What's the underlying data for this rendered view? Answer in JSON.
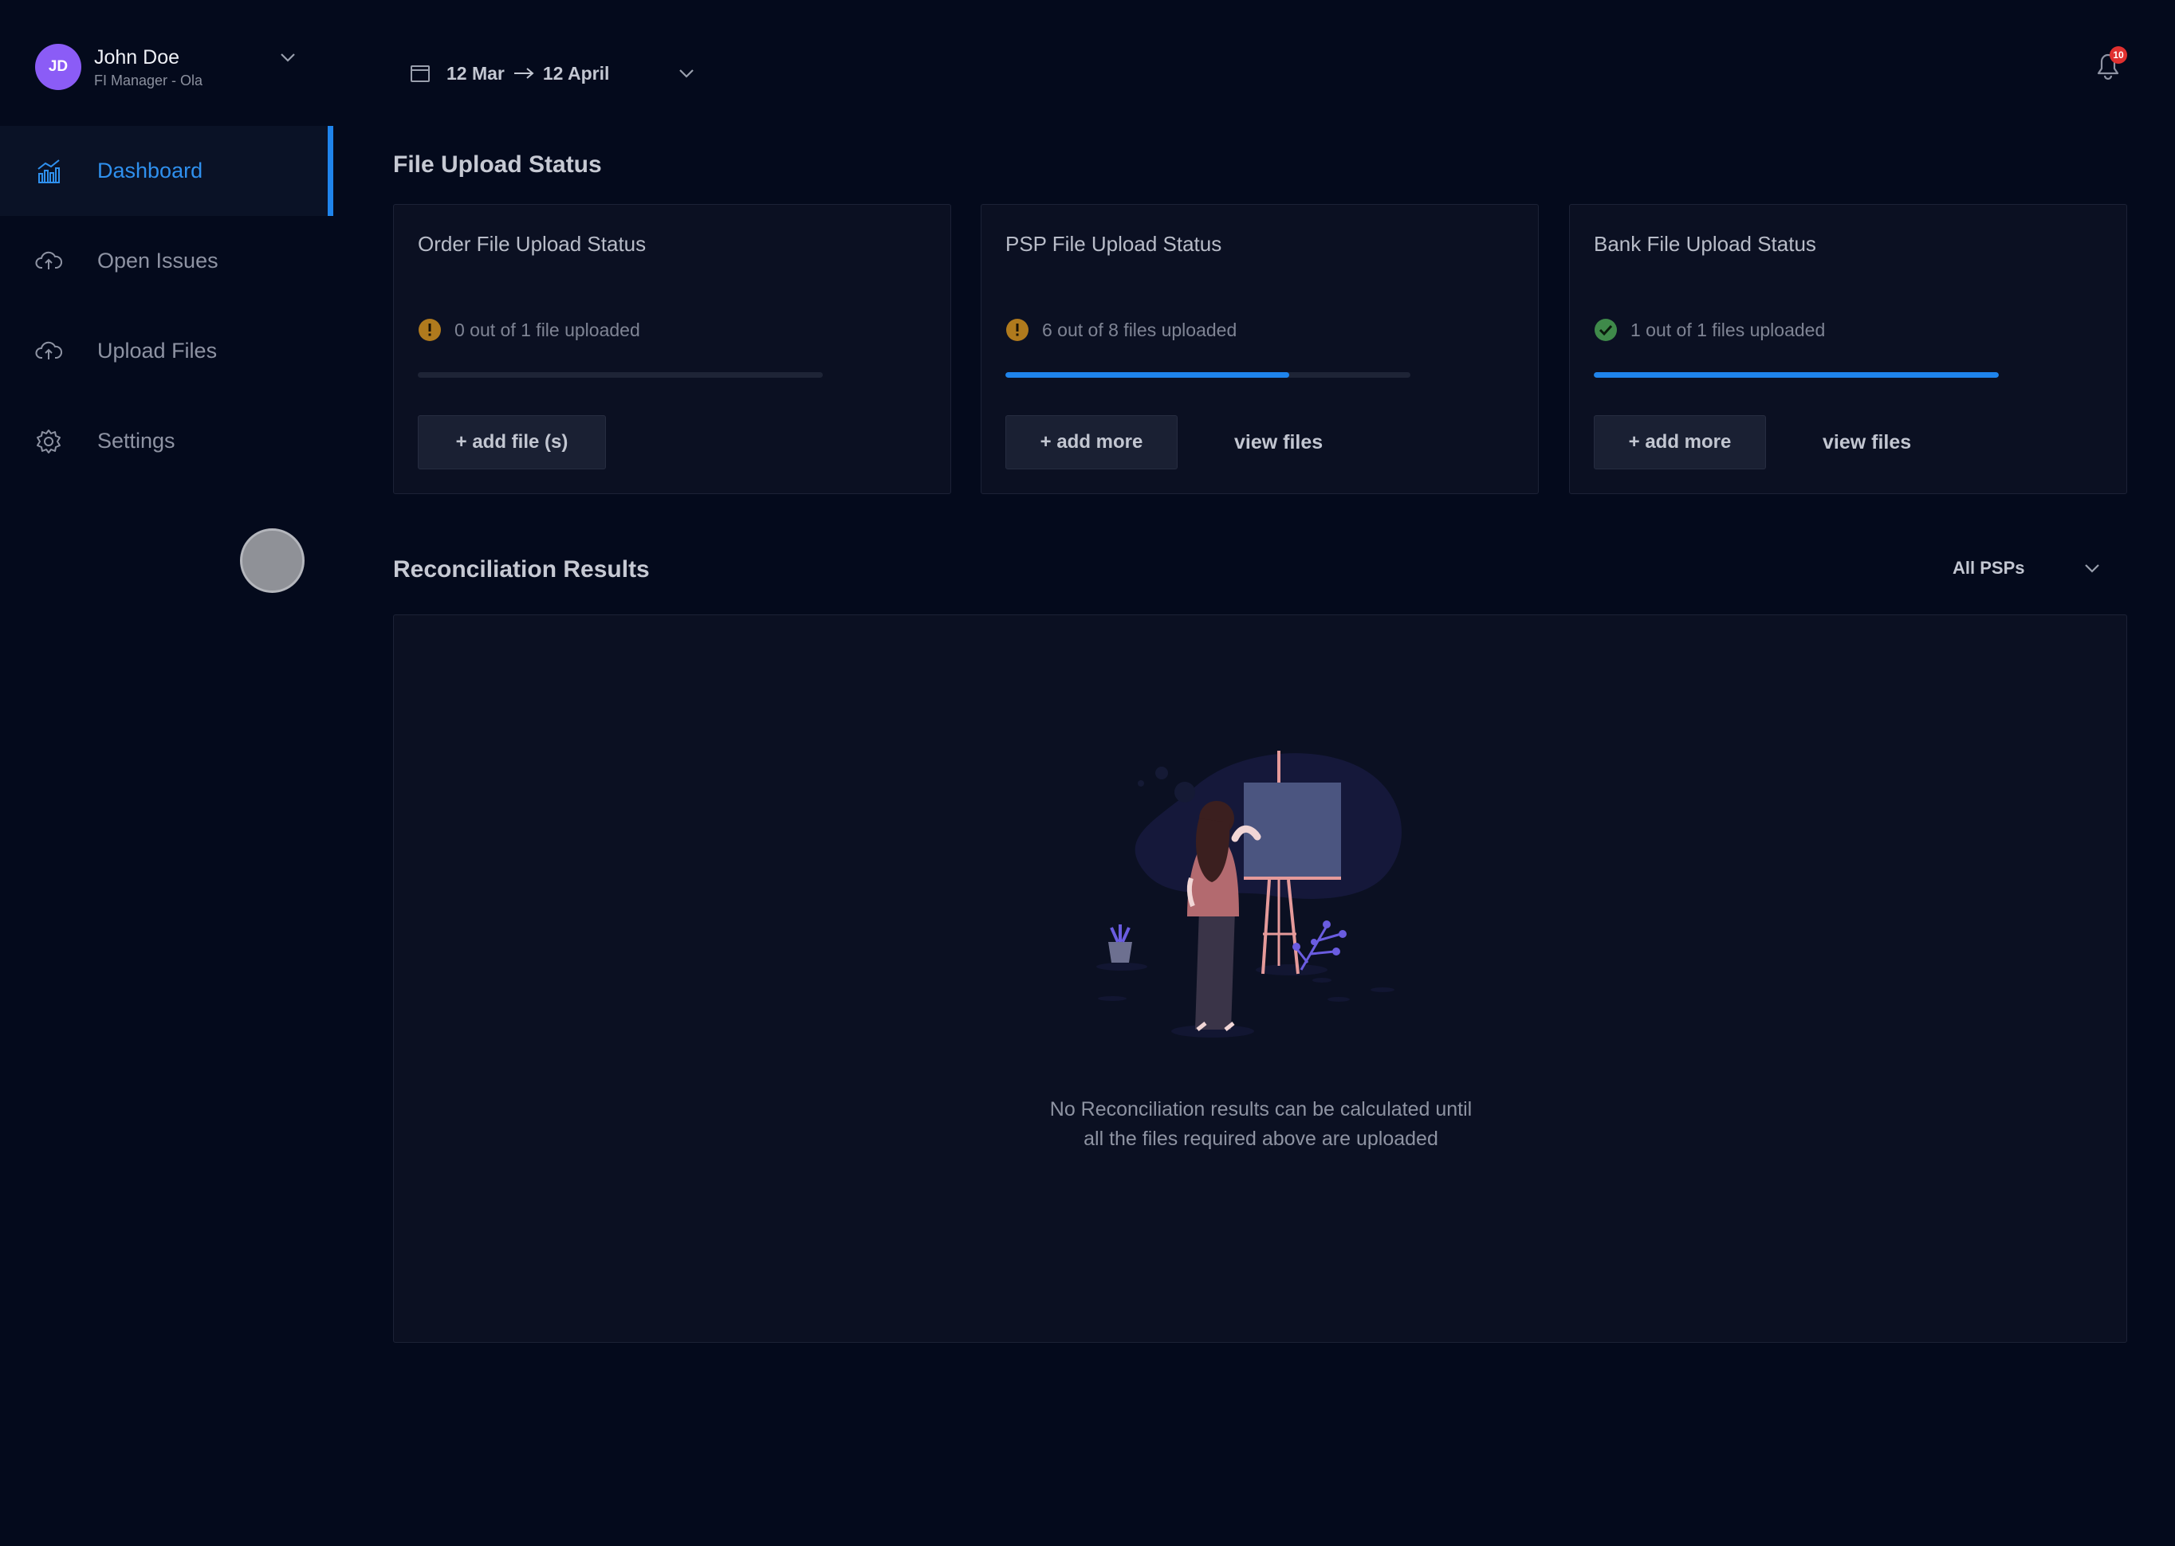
{
  "user": {
    "initials": "JD",
    "name": "John Doe",
    "role": "FI Manager - Ola"
  },
  "sidebar": {
    "items": [
      {
        "label": "Dashboard",
        "icon": "chart-icon",
        "active": true
      },
      {
        "label": "Open Issues",
        "icon": "cloud-upload-icon",
        "active": false
      },
      {
        "label": "Upload Files",
        "icon": "cloud-upload-icon",
        "active": false
      },
      {
        "label": "Settings",
        "icon": "gear-icon",
        "active": false
      }
    ]
  },
  "header": {
    "date_from": "12 Mar",
    "date_to": "12 April",
    "notification_count": "10"
  },
  "upload_status": {
    "title": "File Upload Status",
    "cards": [
      {
        "title": "Order File Upload Status",
        "status_text": "0 out of 1 file uploaded",
        "status": "warning",
        "progress": 0,
        "primary_label": "+ add file (s)",
        "secondary_label": ""
      },
      {
        "title": "PSP File Upload Status",
        "status_text": "6 out of 8 files uploaded",
        "status": "warning",
        "progress": 0.7,
        "primary_label": "+ add more",
        "secondary_label": "view files"
      },
      {
        "title": "Bank File Upload Status",
        "status_text": "1 out of 1 files uploaded",
        "status": "success",
        "progress": 1,
        "primary_label": "+ add more",
        "secondary_label": "view files"
      }
    ]
  },
  "reconciliation": {
    "title": "Reconciliation Results",
    "filter_value": "All PSPs",
    "empty_line1": "No Reconciliation results can be calculated until",
    "empty_line2": "all the files required above are uploaded"
  },
  "colors": {
    "background": "#040a1c",
    "accent": "#1f84ec",
    "warning": "#b07a1d",
    "success": "#3f8a4a",
    "avatar": "#8b5cf6"
  }
}
